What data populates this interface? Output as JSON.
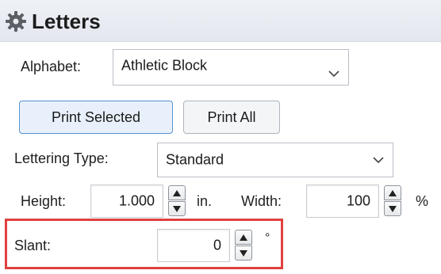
{
  "panel": {
    "title": "Letters"
  },
  "alphabet": {
    "label": "Alphabet:",
    "value": "Athletic Block"
  },
  "buttons": {
    "print_selected": "Print Selected",
    "print_all": "Print All"
  },
  "lettering_type": {
    "label": "Lettering Type:",
    "value": "Standard"
  },
  "height": {
    "label": "Height:",
    "value": "1.000",
    "unit": "in."
  },
  "width": {
    "label": "Width:",
    "value": "100",
    "unit": "%"
  },
  "slant": {
    "label": "Slant:",
    "value": "0",
    "unit": "°"
  },
  "colors": {
    "highlight": "#e0403f",
    "accent": "#5a93cf"
  },
  "icons": {
    "panel": "gear-icon",
    "dropdown": "chevron-down-icon",
    "spin_up": "triangle-up-icon",
    "spin_down": "triangle-down-icon"
  }
}
